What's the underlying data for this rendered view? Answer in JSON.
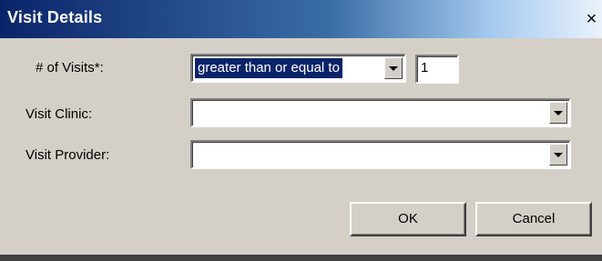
{
  "window": {
    "title": "Visit Details",
    "close_glyph": "×"
  },
  "fields": {
    "visits": {
      "label": "# of Visits*:",
      "operator_selected": "greater than or equal to",
      "count_value": "1"
    },
    "clinic": {
      "label": "Visit Clinic:",
      "value": ""
    },
    "provider": {
      "label": "Visit Provider:",
      "value": ""
    }
  },
  "buttons": {
    "ok": "OK",
    "cancel": "Cancel"
  },
  "icons": {
    "close": "close-icon",
    "dropdown": "chevron-down-icon"
  },
  "colors": {
    "title_start": "#0a246a",
    "title_end": "#eaf2fb",
    "face": "#d4d0c8",
    "highlight": "#0a246a"
  }
}
